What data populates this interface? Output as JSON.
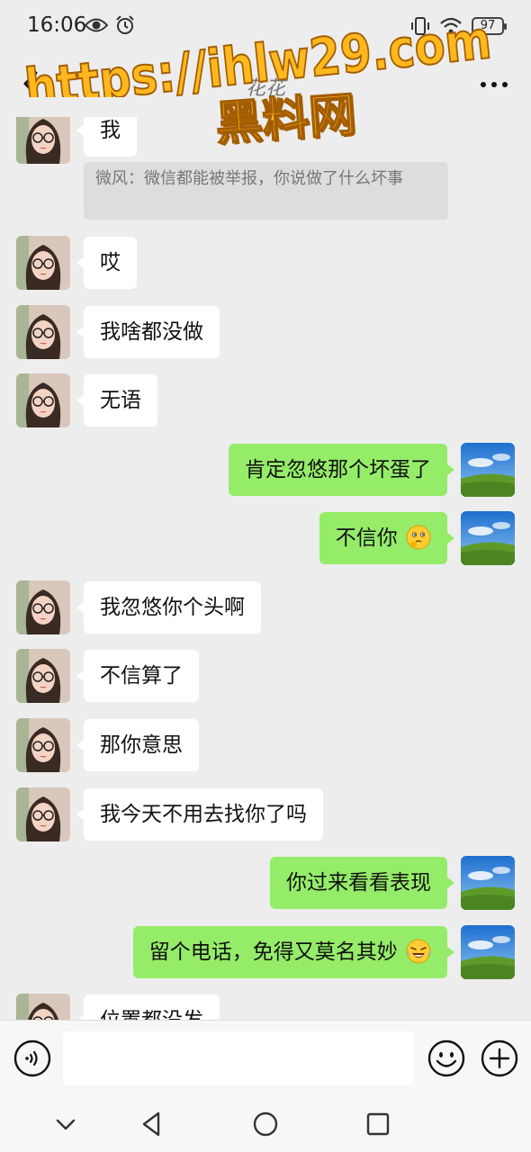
{
  "status_bar": {
    "time": "16:06",
    "battery": "97",
    "icons": [
      "eye-icon",
      "alarm-icon",
      "vibrate-icon",
      "wifi-icon",
      "battery-icon"
    ]
  },
  "header": {
    "title": "花花",
    "back_icon": "chevron-left-icon",
    "more_icon": "more-icon"
  },
  "watermark": {
    "line1": "https://ihlw29.com",
    "line2": "黑料网",
    "color": "#ffb81e"
  },
  "messages": [
    {
      "side": "left",
      "text": "我",
      "quote": "微风：微信都能被举报，你说做了什么坏事"
    },
    {
      "side": "left",
      "text": "哎"
    },
    {
      "side": "left",
      "text": "我啥都没做"
    },
    {
      "side": "left",
      "text": "无语"
    },
    {
      "side": "right",
      "text": "肯定忽悠那个坏蛋了"
    },
    {
      "side": "right",
      "text": "不信你",
      "emoji": "thinking-face-icon"
    },
    {
      "side": "left",
      "text": "我忽悠你个头啊"
    },
    {
      "side": "left",
      "text": "不信算了"
    },
    {
      "side": "left",
      "text": "那你意思"
    },
    {
      "side": "left",
      "text": "我今天不用去找你了吗"
    },
    {
      "side": "right",
      "text": "你过来看看表现"
    },
    {
      "side": "right",
      "text": "留个电话，免得又莫名其妙",
      "emoji": "crying-laughing-face-icon"
    },
    {
      "side": "left",
      "text": "位置都没发"
    }
  ],
  "input": {
    "placeholder": "",
    "voice_icon": "voice-icon",
    "emoji_icon": "smiley-icon",
    "plus_icon": "plus-icon"
  },
  "colors": {
    "background": "#ededed",
    "bubble_left": "#ffffff",
    "bubble_right": "#95ec69",
    "quote_bg": "#dddddd"
  }
}
